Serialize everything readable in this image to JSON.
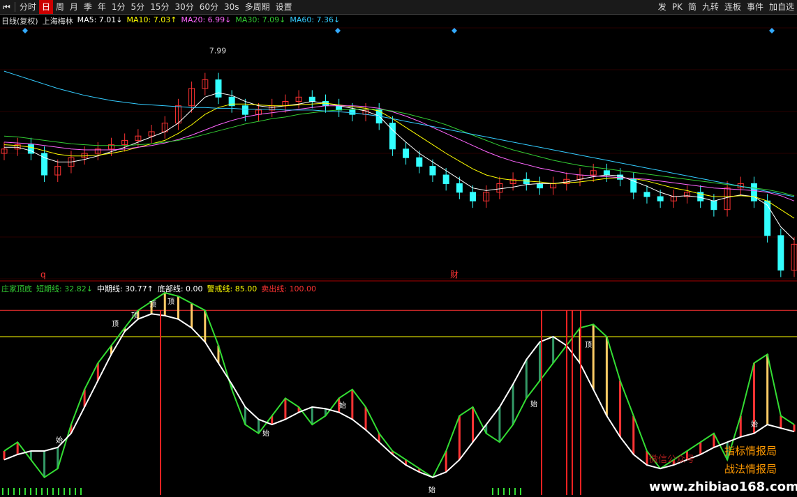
{
  "toolbar": {
    "nav_icon": "skip-back-icon",
    "items": [
      "分时",
      "日",
      "周",
      "月",
      "季",
      "年",
      "1分",
      "5分",
      "15分",
      "30分",
      "60分",
      "30s",
      "多周期",
      "设置"
    ],
    "active": "日",
    "right_items": [
      "发",
      "PK",
      "简",
      "九转",
      "连板",
      "事件",
      "加自选"
    ]
  },
  "price_panel": {
    "period": "日线(复权)",
    "name": "上海梅林",
    "ma": [
      {
        "label": "MA5",
        "value": "7.01",
        "arrow": "↓",
        "color": "#ffffff"
      },
      {
        "label": "MA10",
        "value": "7.03",
        "arrow": "↑",
        "color": "#ffff00"
      },
      {
        "label": "MA20",
        "value": "6.99",
        "arrow": "↓",
        "color": "#ff66ff"
      },
      {
        "label": "MA30",
        "value": "7.09",
        "arrow": "↓",
        "color": "#33cc33"
      },
      {
        "label": "MA60",
        "value": "7.36",
        "arrow": "↓",
        "color": "#33ccff"
      }
    ],
    "high_label": "7.99",
    "markers": [
      "q",
      "财"
    ]
  },
  "indicator_panel": {
    "name": "庄家顶底",
    "lines": [
      {
        "label": "短期线",
        "value": "32.82",
        "arrow": "↓",
        "color": "#33cc33"
      },
      {
        "label": "中期线",
        "value": "30.77",
        "arrow": "↑",
        "color": "#ffffff"
      },
      {
        "label": "底部线",
        "value": "0.00",
        "arrow": "",
        "color": "#ffffff"
      },
      {
        "label": "警戒线",
        "value": "85.00",
        "arrow": "",
        "color": "#ffff00"
      },
      {
        "label": "卖出线",
        "value": "100.00",
        "arrow": "",
        "color": "#ff3333"
      }
    ],
    "signal_labels": {
      "start": "始",
      "top": "顶"
    }
  },
  "watermark": {
    "line1": "指标情报局",
    "line2": "战法情报局",
    "seal": "微信公众号",
    "url": "www.zhibiao168.com"
  },
  "chart_data": {
    "type": "line",
    "description": "candlestick price chart with moving averages and an oscillator sub-chart",
    "price": {
      "y_range": [
        5.4,
        8.3
      ],
      "annotated_high": 7.99,
      "closes": [
        6.9,
        6.95,
        6.85,
        6.6,
        6.7,
        6.8,
        6.85,
        6.9,
        6.95,
        7.0,
        7.05,
        7.1,
        7.2,
        7.4,
        7.6,
        7.7,
        7.5,
        7.4,
        7.3,
        7.35,
        7.4,
        7.45,
        7.5,
        7.45,
        7.4,
        7.35,
        7.3,
        7.35,
        7.2,
        6.9,
        6.8,
        6.7,
        6.6,
        6.5,
        6.4,
        6.3,
        6.4,
        6.5,
        6.55,
        6.5,
        6.45,
        6.5,
        6.55,
        6.6,
        6.65,
        6.6,
        6.55,
        6.4,
        6.35,
        6.3,
        6.35,
        6.4,
        6.3,
        6.2,
        6.45,
        6.5,
        6.3,
        5.9,
        5.5,
        5.8
      ],
      "ma5": [
        6.92,
        6.92,
        6.88,
        6.8,
        6.75,
        6.75,
        6.78,
        6.82,
        6.87,
        6.92,
        6.98,
        7.04,
        7.1,
        7.2,
        7.35,
        7.5,
        7.55,
        7.52,
        7.45,
        7.4,
        7.38,
        7.4,
        7.42,
        7.45,
        7.43,
        7.4,
        7.37,
        7.34,
        7.28,
        7.12,
        6.98,
        6.85,
        6.75,
        6.65,
        6.55,
        6.45,
        6.42,
        6.44,
        6.46,
        6.49,
        6.5,
        6.5,
        6.52,
        6.55,
        6.58,
        6.6,
        6.59,
        6.53,
        6.47,
        6.4,
        6.35,
        6.36,
        6.34,
        6.3,
        6.34,
        6.37,
        6.35,
        6.25,
        6.0,
        5.85
      ],
      "ma10": [
        6.95,
        6.94,
        6.92,
        6.88,
        6.84,
        6.82,
        6.82,
        6.83,
        6.85,
        6.88,
        6.92,
        6.96,
        7.0,
        7.08,
        7.18,
        7.3,
        7.38,
        7.42,
        7.42,
        7.41,
        7.4,
        7.4,
        7.41,
        7.42,
        7.43,
        7.41,
        7.39,
        7.37,
        7.34,
        7.25,
        7.15,
        7.05,
        6.95,
        6.85,
        6.76,
        6.67,
        6.6,
        6.56,
        6.54,
        6.53,
        6.52,
        6.5,
        6.51,
        6.52,
        6.54,
        6.56,
        6.57,
        6.56,
        6.53,
        6.49,
        6.45,
        6.42,
        6.38,
        6.35,
        6.35,
        6.36,
        6.35,
        6.3,
        6.2,
        6.1
      ],
      "ma20": [
        6.98,
        6.97,
        6.96,
        6.94,
        6.92,
        6.9,
        6.89,
        6.89,
        6.89,
        6.9,
        6.92,
        6.94,
        6.97,
        7.01,
        7.06,
        7.12,
        7.18,
        7.23,
        7.27,
        7.3,
        7.32,
        7.34,
        7.36,
        7.38,
        7.4,
        7.4,
        7.4,
        7.39,
        7.37,
        7.33,
        7.28,
        7.22,
        7.15,
        7.08,
        7.01,
        6.94,
        6.87,
        6.81,
        6.76,
        6.72,
        6.68,
        6.65,
        6.62,
        6.6,
        6.59,
        6.58,
        6.57,
        6.56,
        6.55,
        6.53,
        6.51,
        6.49,
        6.47,
        6.45,
        6.44,
        6.43,
        6.42,
        6.4,
        6.36,
        6.3
      ],
      "ma30": [
        7.05,
        7.04,
        7.02,
        7.0,
        6.98,
        6.96,
        6.95,
        6.94,
        6.94,
        6.94,
        6.95,
        6.96,
        6.98,
        7.0,
        7.03,
        7.07,
        7.11,
        7.15,
        7.19,
        7.22,
        7.25,
        7.27,
        7.3,
        7.32,
        7.34,
        7.35,
        7.36,
        7.36,
        7.36,
        7.34,
        7.31,
        7.27,
        7.23,
        7.18,
        7.12,
        7.06,
        7.0,
        6.94,
        6.89,
        6.85,
        6.81,
        6.77,
        6.74,
        6.71,
        6.69,
        6.67,
        6.65,
        6.63,
        6.61,
        6.59,
        6.57,
        6.55,
        6.53,
        6.51,
        6.49,
        6.47,
        6.45,
        6.43,
        6.4,
        6.36
      ],
      "ma60": [
        7.8,
        7.75,
        7.7,
        7.65,
        7.6,
        7.56,
        7.52,
        7.49,
        7.46,
        7.44,
        7.42,
        7.41,
        7.4,
        7.39,
        7.38,
        7.38,
        7.37,
        7.37,
        7.36,
        7.36,
        7.36,
        7.35,
        7.35,
        7.35,
        7.34,
        7.33,
        7.32,
        7.3,
        7.28,
        7.25,
        7.22,
        7.19,
        7.16,
        7.13,
        7.1,
        7.07,
        7.04,
        7.01,
        6.98,
        6.95,
        6.92,
        6.89,
        6.86,
        6.83,
        6.8,
        6.77,
        6.74,
        6.71,
        6.68,
        6.65,
        6.62,
        6.59,
        6.56,
        6.53,
        6.5,
        6.47,
        6.44,
        6.41,
        6.38,
        6.35
      ]
    },
    "oscillator": {
      "y_range": [
        -5,
        110
      ],
      "reference_lines": {
        "警戒线": 85,
        "卖出线": 100,
        "底部线": 0
      },
      "short_term": [
        20,
        25,
        15,
        5,
        10,
        35,
        55,
        70,
        80,
        90,
        100,
        105,
        110,
        108,
        104,
        100,
        80,
        55,
        35,
        30,
        40,
        50,
        45,
        35,
        40,
        50,
        55,
        45,
        30,
        20,
        15,
        10,
        5,
        20,
        40,
        45,
        30,
        25,
        35,
        50,
        60,
        70,
        80,
        90,
        92,
        85,
        60,
        40,
        20,
        10,
        15,
        20,
        25,
        30,
        15,
        40,
        70,
        75,
        40,
        35
      ],
      "mid_term": [
        15,
        18,
        20,
        20,
        22,
        30,
        45,
        60,
        75,
        88,
        95,
        98,
        97,
        95,
        90,
        82,
        70,
        58,
        45,
        38,
        35,
        38,
        42,
        45,
        44,
        42,
        38,
        32,
        25,
        18,
        12,
        8,
        5,
        8,
        15,
        25,
        35,
        45,
        58,
        72,
        82,
        85,
        80,
        70,
        55,
        40,
        28,
        18,
        12,
        10,
        12,
        15,
        18,
        22,
        25,
        28,
        30,
        35,
        33,
        31
      ]
    }
  }
}
